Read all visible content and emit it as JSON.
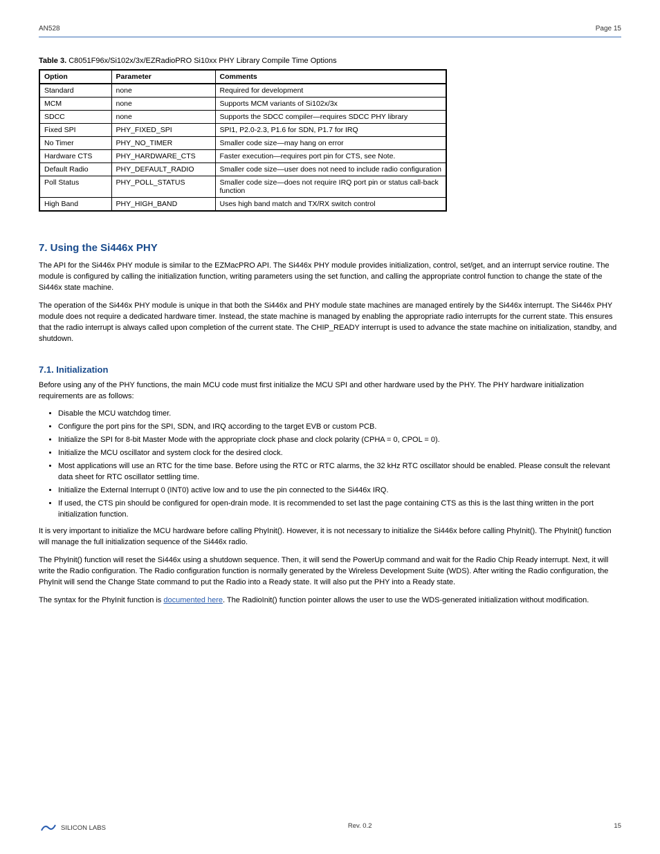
{
  "header": {
    "left": "AN528",
    "right": "Page 15"
  },
  "table": {
    "caption_label": "Table 3.",
    "caption_text": "C8051F96x/Si102x/3x/EZRadioPRO Si10xx PHY Library Compile Time Options",
    "headers": [
      "Option",
      "Parameter",
      "Comments"
    ],
    "rows": [
      [
        "Standard",
        "none",
        "Required for development"
      ],
      [
        "MCM",
        "none",
        "Supports MCM variants of Si102x/3x"
      ],
      [
        "SDCC",
        "none",
        "Supports the SDCC compiler—requires SDCC PHY library"
      ],
      [
        "Fixed SPI",
        "PHY_FIXED_SPI",
        "SPI1, P2.0-2.3, P1.6 for SDN, P1.7 for IRQ"
      ],
      [
        "No Timer",
        "PHY_NO_TIMER",
        "Smaller code size—may hang on error"
      ],
      [
        "Hardware CTS",
        "PHY_HARDWARE_CTS",
        "Faster execution—requires port pin for CTS, see Note."
      ],
      [
        "Default Radio",
        "PHY_DEFAULT_RADIO",
        "Smaller code size—user does not need to include radio configuration"
      ],
      [
        "Poll Status",
        "PHY_POLL_STATUS",
        "Smaller code size—does not require IRQ port pin or status call-back function"
      ],
      [
        "High Band",
        "PHY_HIGH_BAND",
        "Uses high band match and TX/RX switch control"
      ]
    ]
  },
  "section": {
    "title": "7.  Using the Si446x PHY",
    "paragraphs": [
      "The API for the Si446x PHY module is similar to the EZMacPRO API. The Si446x PHY module provides initialization, control, set/get, and an interrupt service routine. The module is configured by calling the initialization function, writing parameters using the set function, and calling the appropriate control function to change the state of the Si446x state machine.",
      "The operation of the Si446x PHY module is unique in that both the Si446x and PHY module state machines are managed entirely by the Si446x interrupt. The Si446x PHY module does not require a dedicated hardware timer. Instead, the state machine is managed by enabling the appropriate radio interrupts for the current state. This ensures that the radio interrupt is always called upon completion of the current state. The CHIP_READY interrupt is used to advance the state machine on initialization, standby, and shutdown."
    ],
    "sub_title": "7.1.  Initialization",
    "sub_intro": "Before using any of the PHY functions, the main MCU code must first initialize the MCU SPI and other hardware used by the PHY. The PHY hardware initialization requirements are as follows:",
    "bullets": [
      "Disable the MCU watchdog timer.",
      "Configure the port pins for the SPI, SDN, and IRQ according to the target EVB or custom PCB.",
      "Initialize the SPI for 8-bit Master Mode with the appropriate clock phase and clock polarity (CPHA = 0, CPOL = 0).",
      "Initialize the MCU oscillator and system clock for the desired clock.",
      "Most applications will use an RTC for the time base. Before using the RTC or RTC alarms, the 32 kHz RTC oscillator should be enabled. Please consult the relevant data sheet for RTC oscillator settling time.",
      "Initialize the External Interrupt 0 (INT0) active low and to use the pin connected to the Si446x IRQ.",
      "If used, the CTS pin should be configured for open-drain mode. It is recommended to set last the page containing CTS as this is the last thing written in the port initialization function."
    ],
    "sub_para_a": "It is very important to initialize the MCU hardware before calling PhyInit(). However, it is not necessary to initialize the Si446x before calling PhyInit(). The PhyInit() function will manage the full initialization sequence of the Si446x radio.",
    "sub_para_b": "The PhyInit() function will reset the Si446x using a shutdown sequence. Then, it will send the PowerUp command and wait for the Radio Chip Ready interrupt. Next, it will write the Radio configuration. The Radio configuration function is normally generated by the Wireless Development Suite (WDS). After writing the Radio configuration, the PhyInit will send the Change State command to put the Radio into a Ready state. It will also put the PHY into a Ready state.",
    "sub_para_c_pre": "The syntax for the PhyInit function is ",
    "sub_para_c_link": "documented here",
    "sub_para_c_post": ". The RadioInit() function pointer allows the user to use the WDS-generated initialization without modification."
  },
  "footer": {
    "brand": "SILICON LABS",
    "right": "Rev. 0.2",
    "page": "15"
  }
}
